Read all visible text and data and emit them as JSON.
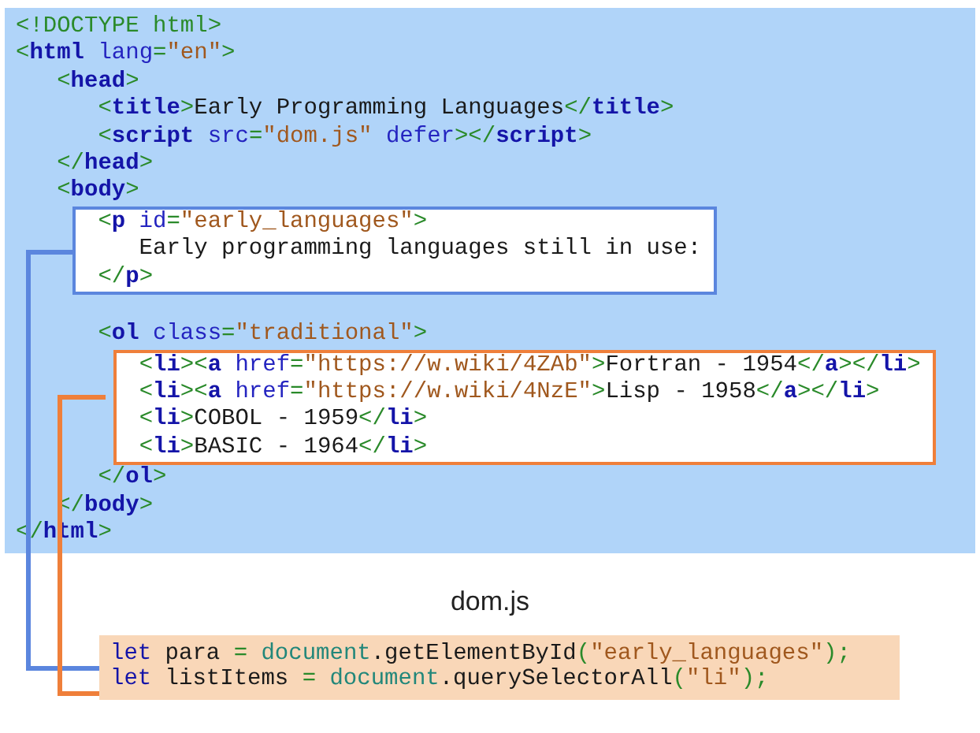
{
  "html_file": {
    "nodes": [
      {
        "kind": "line",
        "tokens": [
          {
            "kind": "punct",
            "text": "<!DOCTYPE html>"
          }
        ]
      },
      {
        "kind": "line",
        "tokens": [
          {
            "kind": "punct",
            "text": "<"
          },
          {
            "kind": "tag",
            "text": "html"
          },
          {
            "kind": "attr",
            "text": " lang"
          },
          {
            "kind": "punct",
            "text": "="
          },
          {
            "kind": "string",
            "text": "\"en\""
          },
          {
            "kind": "punct",
            "text": ">"
          }
        ],
        "children": [
          {
            "kind": "line",
            "tokens": [
              {
                "kind": "punct",
                "text": "<"
              },
              {
                "kind": "tag",
                "text": "head"
              },
              {
                "kind": "punct",
                "text": ">"
              }
            ],
            "children": [
              {
                "kind": "line",
                "tokens": [
                  {
                    "kind": "punct",
                    "text": "<"
                  },
                  {
                    "kind": "tag",
                    "text": "title"
                  },
                  {
                    "kind": "punct",
                    "text": ">"
                  },
                  {
                    "kind": "text",
                    "text": "Early Programming Languages"
                  },
                  {
                    "kind": "punct",
                    "text": "</"
                  },
                  {
                    "kind": "tag",
                    "text": "title"
                  },
                  {
                    "kind": "punct",
                    "text": ">"
                  }
                ]
              },
              {
                "kind": "line",
                "tokens": [
                  {
                    "kind": "punct",
                    "text": "<"
                  },
                  {
                    "kind": "tag",
                    "text": "script"
                  },
                  {
                    "kind": "attr",
                    "text": " src"
                  },
                  {
                    "kind": "punct",
                    "text": "="
                  },
                  {
                    "kind": "string",
                    "text": "\"dom.js\""
                  },
                  {
                    "kind": "attr",
                    "text": " defer"
                  },
                  {
                    "kind": "punct",
                    "text": "></"
                  },
                  {
                    "kind": "tag",
                    "text": "script"
                  },
                  {
                    "kind": "punct",
                    "text": ">"
                  }
                ]
              }
            ]
          },
          {
            "kind": "line",
            "tokens": [
              {
                "kind": "punct",
                "text": "</"
              },
              {
                "kind": "tag",
                "text": "head"
              },
              {
                "kind": "punct",
                "text": ">"
              }
            ]
          },
          {
            "kind": "line",
            "tokens": [
              {
                "kind": "punct",
                "text": "<"
              },
              {
                "kind": "tag",
                "text": "body"
              },
              {
                "kind": "punct",
                "text": ">"
              }
            ],
            "children": [
              {
                "kind": "box",
                "color": "#5b86de",
                "children": [
                  {
                    "kind": "line",
                    "tokens": [
                      {
                        "kind": "punct",
                        "text": "<"
                      },
                      {
                        "kind": "tag",
                        "text": "p"
                      },
                      {
                        "kind": "attr",
                        "text": " id"
                      },
                      {
                        "kind": "punct",
                        "text": "="
                      },
                      {
                        "kind": "string",
                        "text": "\"early_languages\""
                      },
                      {
                        "kind": "punct",
                        "text": ">"
                      }
                    ],
                    "children": [
                      {
                        "kind": "line",
                        "tokens": [
                          {
                            "kind": "text",
                            "text": "Early programming languages still in use:"
                          }
                        ]
                      }
                    ]
                  },
                  {
                    "kind": "line",
                    "tokens": [
                      {
                        "kind": "punct",
                        "text": "</"
                      },
                      {
                        "kind": "tag",
                        "text": "p"
                      },
                      {
                        "kind": "punct",
                        "text": ">"
                      }
                    ]
                  }
                ]
              },
              {
                "kind": "blank"
              },
              {
                "kind": "line",
                "tokens": [
                  {
                    "kind": "punct",
                    "text": "<"
                  },
                  {
                    "kind": "tag",
                    "text": "ol"
                  },
                  {
                    "kind": "attr",
                    "text": " class"
                  },
                  {
                    "kind": "punct",
                    "text": "="
                  },
                  {
                    "kind": "string",
                    "text": "\"traditional\""
                  },
                  {
                    "kind": "punct",
                    "text": ">"
                  }
                ],
                "children": [
                  {
                    "kind": "box",
                    "color": "#ef7f3a",
                    "children": [
                      {
                        "kind": "line",
                        "tokens": [
                          {
                            "kind": "punct",
                            "text": "<"
                          },
                          {
                            "kind": "tag",
                            "text": "li"
                          },
                          {
                            "kind": "punct",
                            "text": "><"
                          },
                          {
                            "kind": "tag",
                            "text": "a"
                          },
                          {
                            "kind": "attr",
                            "text": " href"
                          },
                          {
                            "kind": "punct",
                            "text": "="
                          },
                          {
                            "kind": "string",
                            "text": "\"https://w.wiki/4ZAb\""
                          },
                          {
                            "kind": "punct",
                            "text": ">"
                          },
                          {
                            "kind": "text",
                            "text": "Fortran - 1954"
                          },
                          {
                            "kind": "punct",
                            "text": "</"
                          },
                          {
                            "kind": "tag",
                            "text": "a"
                          },
                          {
                            "kind": "punct",
                            "text": "></"
                          },
                          {
                            "kind": "tag",
                            "text": "li"
                          },
                          {
                            "kind": "punct",
                            "text": ">"
                          }
                        ]
                      },
                      {
                        "kind": "line",
                        "tokens": [
                          {
                            "kind": "punct",
                            "text": "<"
                          },
                          {
                            "kind": "tag",
                            "text": "li"
                          },
                          {
                            "kind": "punct",
                            "text": "><"
                          },
                          {
                            "kind": "tag",
                            "text": "a"
                          },
                          {
                            "kind": "attr",
                            "text": " href"
                          },
                          {
                            "kind": "punct",
                            "text": "="
                          },
                          {
                            "kind": "string",
                            "text": "\"https://w.wiki/4NzE\""
                          },
                          {
                            "kind": "punct",
                            "text": ">"
                          },
                          {
                            "kind": "text",
                            "text": "Lisp - 1958"
                          },
                          {
                            "kind": "punct",
                            "text": "</"
                          },
                          {
                            "kind": "tag",
                            "text": "a"
                          },
                          {
                            "kind": "punct",
                            "text": "></"
                          },
                          {
                            "kind": "tag",
                            "text": "li"
                          },
                          {
                            "kind": "punct",
                            "text": ">"
                          }
                        ]
                      },
                      {
                        "kind": "line",
                        "tokens": [
                          {
                            "kind": "punct",
                            "text": "<"
                          },
                          {
                            "kind": "tag",
                            "text": "li"
                          },
                          {
                            "kind": "punct",
                            "text": ">"
                          },
                          {
                            "kind": "text",
                            "text": "COBOL - 1959"
                          },
                          {
                            "kind": "punct",
                            "text": "</"
                          },
                          {
                            "kind": "tag",
                            "text": "li"
                          },
                          {
                            "kind": "punct",
                            "text": ">"
                          }
                        ]
                      },
                      {
                        "kind": "line",
                        "tokens": [
                          {
                            "kind": "punct",
                            "text": "<"
                          },
                          {
                            "kind": "tag",
                            "text": "li"
                          },
                          {
                            "kind": "punct",
                            "text": ">"
                          },
                          {
                            "kind": "text",
                            "text": "BASIC - 1964"
                          },
                          {
                            "kind": "punct",
                            "text": "</"
                          },
                          {
                            "kind": "tag",
                            "text": "li"
                          },
                          {
                            "kind": "punct",
                            "text": ">"
                          }
                        ]
                      }
                    ]
                  }
                ]
              },
              {
                "kind": "line",
                "tokens": [
                  {
                    "kind": "punct",
                    "text": "</"
                  },
                  {
                    "kind": "tag",
                    "text": "ol"
                  },
                  {
                    "kind": "punct",
                    "text": ">"
                  }
                ]
              }
            ]
          },
          {
            "kind": "line",
            "tokens": [
              {
                "kind": "punct",
                "text": "</"
              },
              {
                "kind": "tag",
                "text": "body"
              },
              {
                "kind": "punct",
                "text": ">"
              }
            ]
          }
        ]
      },
      {
        "kind": "line",
        "tokens": [
          {
            "kind": "punct",
            "text": "</"
          },
          {
            "kind": "tag",
            "text": "html"
          },
          {
            "kind": "punct",
            "text": ">"
          }
        ]
      }
    ]
  },
  "js_file": {
    "name": "dom.js",
    "lines": [
      [
        {
          "kind": "keyword",
          "text": "let"
        },
        {
          "kind": "text",
          "text": " para "
        },
        {
          "kind": "punct",
          "text": "= "
        },
        {
          "kind": "object",
          "text": "document"
        },
        {
          "kind": "text",
          "text": ".getElementById"
        },
        {
          "kind": "punct",
          "text": "("
        },
        {
          "kind": "string",
          "text": "\"early_languages\""
        },
        {
          "kind": "punct",
          "text": ");"
        }
      ],
      [
        {
          "kind": "keyword",
          "text": "let"
        },
        {
          "kind": "text",
          "text": " listItems "
        },
        {
          "kind": "punct",
          "text": "= "
        },
        {
          "kind": "object",
          "text": "document"
        },
        {
          "kind": "text",
          "text": ".querySelectorAll"
        },
        {
          "kind": "punct",
          "text": "("
        },
        {
          "kind": "string",
          "text": "\"li\""
        },
        {
          "kind": "punct",
          "text": ");"
        }
      ]
    ]
  }
}
